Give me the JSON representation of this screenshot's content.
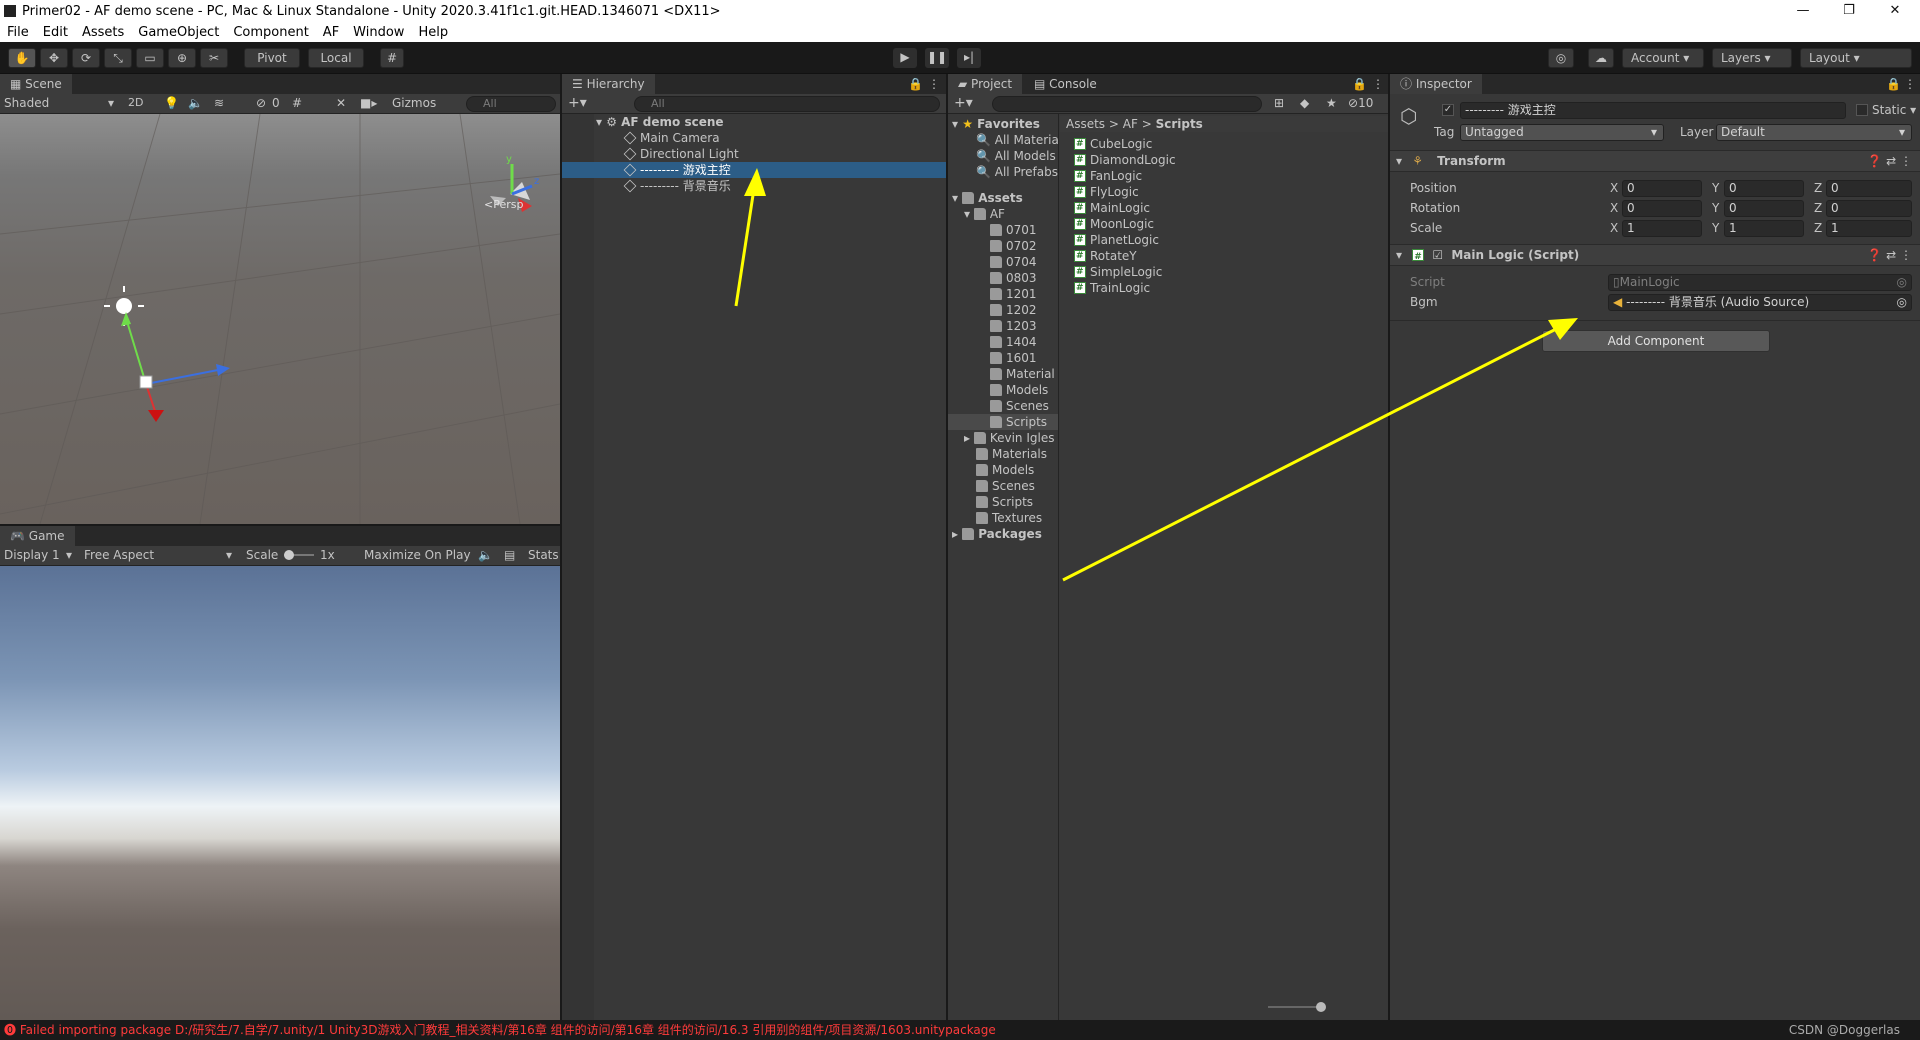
{
  "window": {
    "title": "Primer02 - AF demo scene - PC, Mac & Linux Standalone - Unity 2020.3.41f1c1.git.HEAD.1346071 <DX11>"
  },
  "menu": [
    "File",
    "Edit",
    "Assets",
    "GameObject",
    "Component",
    "AF",
    "Window",
    "Help"
  ],
  "toolbar": {
    "pivot": "Pivot",
    "local": "Local",
    "account": "Account",
    "layers": "Layers",
    "layout": "Layout"
  },
  "scene": {
    "tab": "Scene",
    "shading": "Shaded",
    "mode2d": "2D",
    "hidden_count": "0",
    "gizmos": "Gizmos",
    "search_placeholder": "All",
    "persp": "Persp",
    "axis_y": "y",
    "axis_z": "z"
  },
  "game": {
    "tab": "Game",
    "display": "Display 1",
    "aspect": "Free Aspect",
    "scale_label": "Scale",
    "scale_value": "1x",
    "maximize": "Maximize On Play",
    "stats": "Stats"
  },
  "hierarchy": {
    "tab": "Hierarchy",
    "search_placeholder": "All",
    "scene": "AF demo scene",
    "items": [
      "Main Camera",
      "Directional Light",
      "--------- 游戏主控",
      "--------- 背景音乐"
    ]
  },
  "project": {
    "tab": "Project",
    "console_tab": "Console",
    "hidden_count": "10",
    "favorites": {
      "label": "Favorites",
      "items": [
        "All Materia",
        "All Models",
        "All Prefabs"
      ]
    },
    "assets_label": "Assets",
    "af_label": "AF",
    "af_children": [
      "0701",
      "0702",
      "0704",
      "0803",
      "1201",
      "1202",
      "1203",
      "1404",
      "1601",
      "Material",
      "Models",
      "Scenes",
      "Scripts"
    ],
    "asset_children": [
      "Kevin Igles",
      "Materials",
      "Models",
      "Scenes",
      "Scripts",
      "Textures"
    ],
    "packages": "Packages",
    "breadcrumb": [
      "Assets",
      "AF",
      "Scripts"
    ],
    "scripts": [
      "CubeLogic",
      "DiamondLogic",
      "FanLogic",
      "FlyLogic",
      "MainLogic",
      "MoonLogic",
      "PlanetLogic",
      "RotateY",
      "SimpleLogic",
      "TrainLogic"
    ]
  },
  "inspector": {
    "tab": "Inspector",
    "object_name": "--------- 游戏主控",
    "static": "Static",
    "tag_label": "Tag",
    "tag": "Untagged",
    "layer_label": "Layer",
    "layer": "Default",
    "transform": {
      "title": "Transform",
      "position": "Position",
      "rotation": "Rotation",
      "scale": "Scale",
      "x": "X",
      "y": "Y",
      "z": "Z",
      "pos": [
        "0",
        "0",
        "0"
      ],
      "rot": [
        "0",
        "0",
        "0"
      ],
      "scl": [
        "1",
        "1",
        "1"
      ]
    },
    "script": {
      "title": "Main Logic (Script)",
      "script_label": "Script",
      "script_value": "MainLogic",
      "bgm_label": "Bgm",
      "bgm_value": "--------- 背景音乐 (Audio Source)"
    },
    "add_component": "Add Component"
  },
  "status": {
    "error": "Failed importing package D:/研究生/7.自学/7.unity/1 Unity3D游戏入门教程_相关资料/第16章 组件的访问/第16章 组件的访问/16.3 引用别的组件/项目资源/1603.unitypackage",
    "watermark": "CSDN @Doggerlas"
  },
  "colors": {
    "selection": "#2c5d87",
    "annotation_arrow": "#ffff00",
    "error": "#ff3b3b"
  }
}
